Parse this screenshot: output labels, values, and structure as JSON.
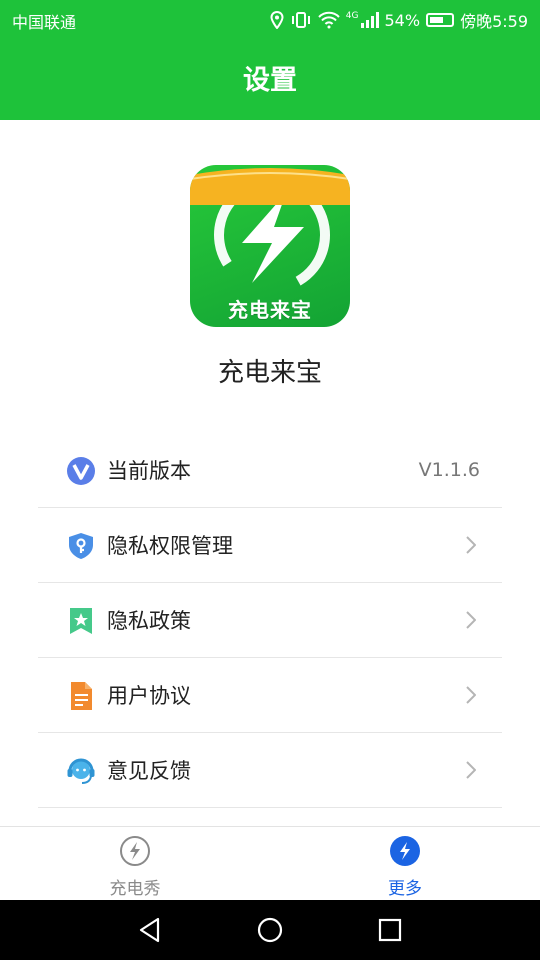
{
  "status_bar": {
    "carrier": "中国联通",
    "network": "4G",
    "battery_percent": "54%",
    "battery_level": 0.54,
    "time": "傍晚5:59",
    "icons": [
      "location-icon",
      "vibrate-icon",
      "wifi-icon",
      "signal-icon",
      "battery-icon"
    ]
  },
  "header": {
    "title": "设置"
  },
  "app": {
    "logo_text": "充电来宝",
    "name": "充电来宝",
    "brand_color": "#1ec23a",
    "banner_color": "#f6b321"
  },
  "menu": {
    "items": [
      {
        "label": "当前版本",
        "value": "V1.1.6",
        "icon": "version-v-icon"
      },
      {
        "label": "隐私权限管理",
        "value": "",
        "icon": "shield-key-icon"
      },
      {
        "label": "隐私政策",
        "value": "",
        "icon": "bookmark-star-icon"
      },
      {
        "label": "用户协议",
        "value": "",
        "icon": "document-icon"
      },
      {
        "label": "意见反馈",
        "value": "",
        "icon": "headset-icon"
      }
    ]
  },
  "tabbar": {
    "tabs": [
      {
        "label": "充电秀",
        "active": false,
        "icon": "bolt-circle-icon"
      },
      {
        "label": "更多",
        "active": true,
        "icon": "bolt-circle-filled-icon"
      }
    ],
    "active_color": "#1b64e3",
    "inactive_color": "#8a8a8a"
  },
  "nav_bar": {
    "buttons": [
      "back-triangle-icon",
      "home-circle-icon",
      "recents-square-icon"
    ]
  }
}
